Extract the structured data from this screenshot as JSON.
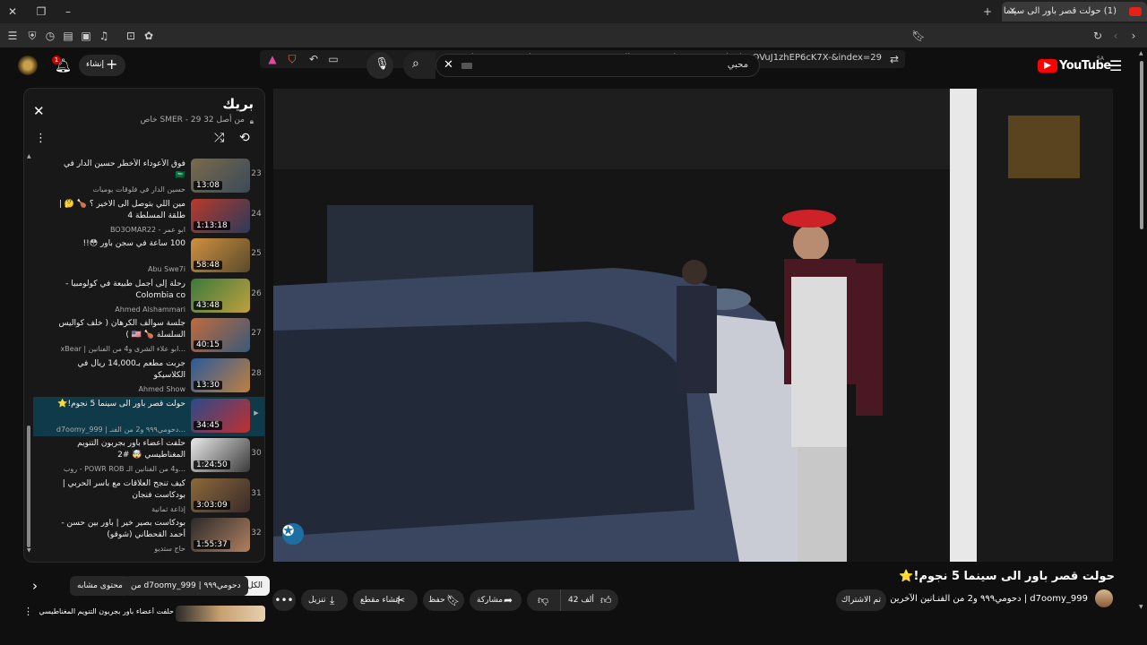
{
  "browser": {
    "tab_title": "(1) حولت قصر باور الى سينما 5",
    "url": "youtube.com/watch?v=_pcEp7MgmA4&list=PLBy5b7R8EE4TDiPPbwOVuJ1zhEP6cK7X-&index=29"
  },
  "header": {
    "logo_text": "YouTube",
    "country": "SA",
    "search_value": "محبي",
    "create_label": "إنشاء",
    "notification_count": "1"
  },
  "playlist": {
    "title": "بريك",
    "subtitle": "خاص SMER - 29 من أصل 32",
    "items": [
      {
        "index": "23",
        "title": "فوق الأعوداء الأخطر حسين الدار في 🇸🇦",
        "channel": "حسين الدار في فلوقات يوميات",
        "duration": "13:08",
        "active": false
      },
      {
        "index": "24",
        "title": "مين اللي بتوصل الى الاخير ؟ 🍗 🤔 | طلقة المسلطة 4",
        "channel": "BO3OMAR22 - ابو عمر",
        "duration": "1:13:18",
        "active": false
      },
      {
        "index": "25",
        "title": "100 ساعة في سجن باور 😳!!",
        "channel": "Abu Swe7i",
        "duration": "58:48",
        "active": false
      },
      {
        "index": "26",
        "title": "رحلة إلى أجمل طبيعة في كولومبيا - Colombia co",
        "channel": "Ahmed Alshammari",
        "duration": "43:48",
        "active": false
      },
      {
        "index": "27",
        "title": "جلسة سوالف الكرهان ( خلف كواليس السلسلة 🍗 🇺🇸 )",
        "channel": "xBear | ابو علاء الشرى و4 من الفنانين...",
        "duration": "40:15",
        "active": false
      },
      {
        "index": "28",
        "title": "جربت مطعم بـ14,000 ريال في الكلاسيكو",
        "channel": "Ahmed Show",
        "duration": "13:30",
        "active": false
      },
      {
        "index": "29",
        "title": "حولت قصر باور الى سينما 5 نجوم!⭐",
        "channel": "d7oomy_999 | دحومي٩٩٩ و2 من الفنـ...",
        "duration": "34:45",
        "active": true
      },
      {
        "index": "30",
        "title": "حلفت أعضاء باور بجربون التنويم المغناطيسي 🤯 #2",
        "channel": "روب - POWR ROB و4 من الفنانين الـ...",
        "duration": "1:24:50",
        "active": false
      },
      {
        "index": "31",
        "title": "كيف تنجح العلاقات مع باسر الحربي | بودكاست فنجان",
        "channel": "إذاعة ثمانية",
        "duration": "3:03:09",
        "active": false
      },
      {
        "index": "32",
        "title": "بودكاست بصير خير | باور بين حسن - أحمد القحطاني (شوقو)",
        "channel": "حاج ستديو",
        "duration": "1:55:37",
        "active": false
      }
    ]
  },
  "video": {
    "title": "حولت قصر باور الى سينما 5 نجوم!⭐",
    "channel": "d7oomy_999 | دحومي٩٩٩ و2 من الفنـانين الآخرين",
    "subscribe_label": "تم الاشتراك",
    "likes": "42 ألف",
    "share_label": "مشاركة",
    "save_label": "حفظ",
    "clip_label": "إنشاء مقطع",
    "download_label": "تنزيل"
  },
  "chips": {
    "all": "الكل",
    "from": "من d7oomy_999 | دحومي٩٩٩",
    "related": "محتوى مشابه"
  },
  "next_row": {
    "title": "حلفت أعضاء باور بجربون التنويم المغناطيسي"
  }
}
